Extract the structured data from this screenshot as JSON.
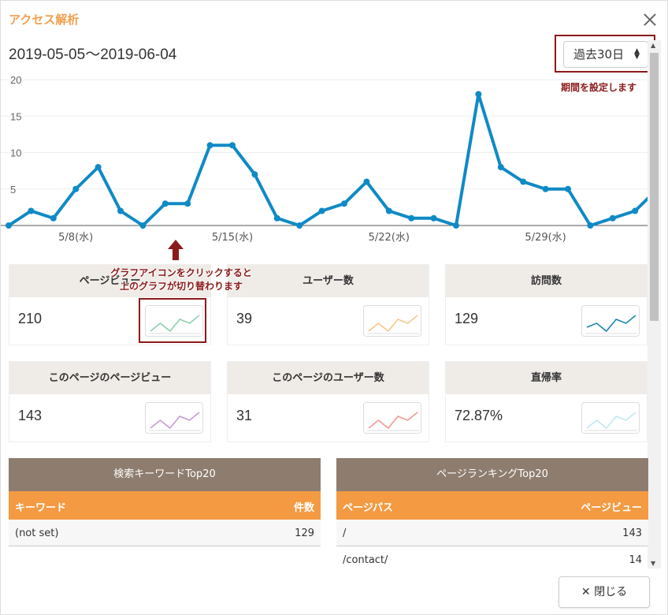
{
  "dialog": {
    "title": "アクセス解析",
    "close_label": "閉じる"
  },
  "date_range": "2019-05-05～2019-06-04",
  "period": {
    "selected": "過去30日",
    "note": "期間を設定します"
  },
  "chart_data": {
    "type": "line",
    "color": "#0f8ac6",
    "ylim": [
      0,
      20
    ],
    "y_ticks": [
      20,
      15,
      10,
      5
    ],
    "x_tick_labels": [
      {
        "index": 3,
        "label": "5/8(水)"
      },
      {
        "index": 10,
        "label": "5/15(水)"
      },
      {
        "index": 17,
        "label": "5/22(水)"
      },
      {
        "index": 24,
        "label": "5/29(水)"
      }
    ],
    "values": [
      0,
      2,
      1,
      5,
      8,
      2,
      0,
      3,
      3,
      11,
      11,
      7,
      1,
      0,
      2,
      3,
      6,
      2,
      1,
      1,
      0,
      18,
      8,
      6,
      5,
      5,
      0,
      1,
      2,
      5
    ]
  },
  "callout": {
    "line1": "グラフアイコンをクリックすると",
    "line2": "上のグラフが切り替わります"
  },
  "stats": [
    {
      "label": "ページビュー",
      "value": "210",
      "color": "#8ccfae",
      "spark": [
        1,
        3,
        1,
        4,
        3,
        5
      ]
    },
    {
      "label": "ユーザー数",
      "value": "39",
      "color": "#f5c78a",
      "spark": [
        1,
        3,
        1,
        4,
        3,
        5
      ]
    },
    {
      "label": "訪問数",
      "value": "129",
      "color": "#1a86b5",
      "spark": [
        2,
        3,
        1,
        4,
        3,
        5
      ]
    },
    {
      "label": "このページのページビュー",
      "value": "143",
      "color": "#c89bd6",
      "spark": [
        1,
        3,
        1,
        4,
        3,
        5
      ]
    },
    {
      "label": "このページのユーザー数",
      "value": "31",
      "color": "#ef9a94",
      "spark": [
        1,
        3,
        1,
        4,
        3,
        5
      ]
    },
    {
      "label": "直帰率",
      "value": "72.87%",
      "color": "#bfe9ee",
      "spark": [
        1,
        3,
        1,
        4,
        3,
        5
      ]
    }
  ],
  "keywords_table": {
    "title": "検索キーワードTop20",
    "col1": "キーワード",
    "col2": "件数",
    "rows": [
      {
        "keyword": "(not set)",
        "count": "129"
      }
    ]
  },
  "pages_table": {
    "title": "ページランキングTop20",
    "col1": "ページパス",
    "col2": "ページビュー",
    "rows": [
      {
        "path": "/",
        "views": "143"
      },
      {
        "path": "/contact/",
        "views": "14"
      }
    ]
  }
}
